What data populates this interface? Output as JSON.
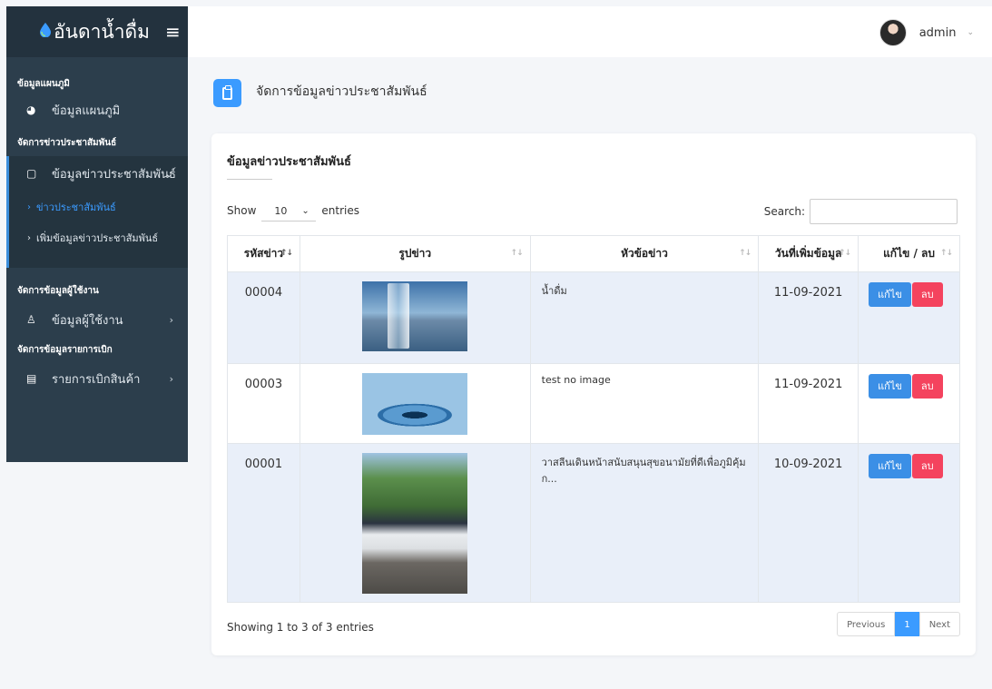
{
  "brand": {
    "title": "อันดาน้ำดื่ม",
    "accent": "#3b9bff"
  },
  "sidebar": {
    "sections": [
      {
        "title": "ข้อมูลแผนภูมิ",
        "items": [
          {
            "label": "ข้อมูลแผนภูมิ",
            "icon": "pie-chart-icon"
          }
        ]
      },
      {
        "title": "จัดการข่าวประชาสัมพันธ์",
        "items": [
          {
            "label": "ข้อมูลข่าวประชาสัมพันธ์",
            "icon": "clipboard-icon",
            "sub": [
              "ข่าวประชาสัมพันธ์",
              "เพิ่มข้อมูลข่าวประชาสัมพันธ์"
            ]
          }
        ]
      },
      {
        "title": "จัดการข้อมูลผู้ใช้งาน",
        "items": [
          {
            "label": "ข้อมูลผู้ใช้งาน",
            "icon": "user-icon"
          }
        ]
      },
      {
        "title": "จัดการข้อมูลรายการเบิก",
        "items": [
          {
            "label": "รายการเบิกสินค้า",
            "icon": "id-card-icon"
          }
        ]
      }
    ]
  },
  "topbar": {
    "username": "admin"
  },
  "page": {
    "title": "จัดการข้อมูลข่าวประชาสัมพันธ์"
  },
  "card": {
    "title": "ข้อมูลข่าวประชาสัมพันธ์",
    "show_label": "Show",
    "entries_value": "10",
    "entries_label": "entries",
    "search_label": "Search:",
    "search_value": ""
  },
  "table": {
    "columns": [
      "รหัสข่าว",
      "รูปข่าว",
      "หัวข้อข่าว",
      "วันที่เพิ่มข้อมูล",
      "แก้ไข / ลบ"
    ],
    "rows": [
      {
        "id": "00004",
        "headline": "น้ำดื่ม",
        "date": "11-09-2021",
        "image": "glass-of-water-image"
      },
      {
        "id": "00003",
        "headline": "test no image",
        "date": "11-09-2021",
        "image": "water-drop-image"
      },
      {
        "id": "00001",
        "headline": "วาสลีนเดินหน้าสนับสนุนสุขอนามัยที่ดีเพื่อภูมิคุ้มก...",
        "date": "10-09-2021",
        "image": "delivery-truck-image"
      }
    ],
    "edit_label": "แก้ไข",
    "delete_label": "ลบ"
  },
  "footer": {
    "info": "Showing 1 to 3 of 3 entries"
  },
  "pagination": {
    "previous": "Previous",
    "current": "1",
    "next": "Next"
  }
}
